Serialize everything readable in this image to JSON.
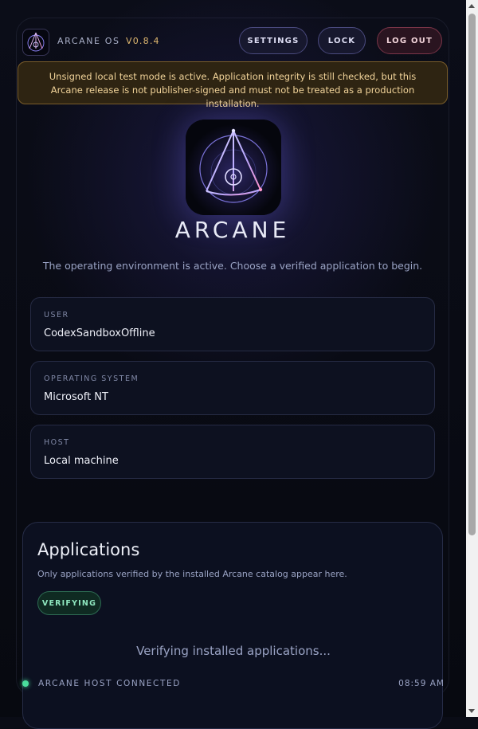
{
  "colors": {
    "accent": "#8f86ff",
    "warning_bg": "#2e2412",
    "warning_text": "#f2d49a",
    "logout": "#7a3548",
    "status_ok": "#4ade9c"
  },
  "header": {
    "logo_icon": "arcane-logo-icon",
    "os_name": "ARCANE OS",
    "version": "V0.8.4",
    "buttons": {
      "settings": "SETTINGS",
      "lock": "LOCK",
      "logout": "LOG OUT"
    }
  },
  "warning": {
    "text": "Unsigned local test mode is active. Application integrity is still checked, but this Arcane release is not publisher-signed and must not be treated as a production installation."
  },
  "hero": {
    "logo_icon": "arcane-logo-icon",
    "title": "ARCANE",
    "subtitle": "The operating environment is active. Choose a verified application to begin."
  },
  "info_cards": [
    {
      "label": "USER",
      "value": "CodexSandboxOffline"
    },
    {
      "label": "OPERATING SYSTEM",
      "value": "Microsoft NT"
    },
    {
      "label": "HOST",
      "value": "Local machine"
    }
  ],
  "applications": {
    "title": "Applications",
    "subtitle": "Only applications verified by the installed Arcane catalog appear here.",
    "badge": "VERIFYING",
    "status": "Verifying installed applications..."
  },
  "footer": {
    "status_text": "ARCANE HOST CONNECTED",
    "time": "08:59 AM"
  }
}
